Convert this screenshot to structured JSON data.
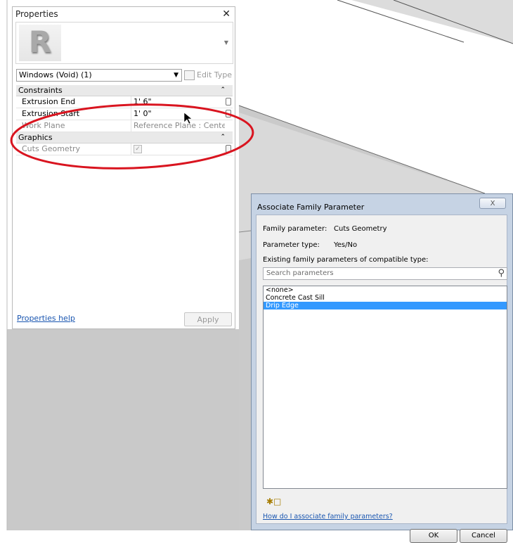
{
  "properties": {
    "title": "Properties",
    "close_glyph": "✕",
    "logo_letter": "R",
    "type_selector": "Windows (Void) (1)",
    "edit_type_label": "Edit Type",
    "groups": {
      "constraints": "Constraints",
      "graphics": "Graphics"
    },
    "rows": [
      {
        "label": "Extrusion End",
        "value": "1'  6\""
      },
      {
        "label": "Extrusion Start",
        "value": "1'  0\""
      },
      {
        "label": "Work Plane",
        "value": "Reference Plane : Center (..."
      }
    ],
    "cuts_geometry": {
      "label": "Cuts Geometry",
      "checked": true
    },
    "help_link": "Properties help",
    "apply_label": "Apply"
  },
  "dialog": {
    "title": "Associate Family Parameter",
    "close_glyph": "X",
    "family_parameter_label": "Family parameter:",
    "family_parameter_value": "Cuts Geometry",
    "parameter_type_label": "Parameter type:",
    "parameter_type_value": "Yes/No",
    "existing_label": "Existing family parameters of compatible type:",
    "search_placeholder": "Search parameters",
    "items": [
      "<none>",
      "Concrete Cast Sill",
      "Drip Edge"
    ],
    "selected_index": 2,
    "help_link": "How do I associate family parameters?",
    "ok_label": "OK",
    "cancel_label": "Cancel"
  },
  "colors": {
    "annotation": "#d9141f",
    "selection": "#3399ff",
    "link": "#1a56b0"
  }
}
